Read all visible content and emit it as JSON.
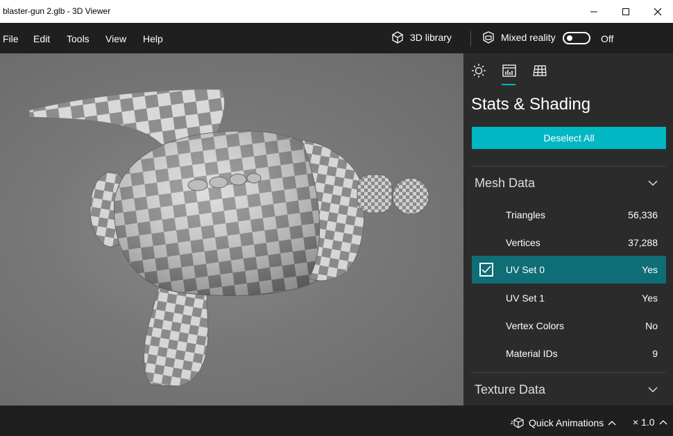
{
  "window": {
    "title": "blaster-gun 2.glb - 3D Viewer"
  },
  "menu": {
    "items": [
      "File",
      "Edit",
      "Tools",
      "View",
      "Help"
    ]
  },
  "toolbar": {
    "library_label": "3D library",
    "mixed_reality_label": "Mixed reality",
    "mixed_reality_state": "Off"
  },
  "panel": {
    "tabs": [
      "lighting-tab",
      "stats-tab",
      "grid-tab"
    ],
    "title": "Stats & Shading",
    "deselect_label": "Deselect All",
    "mesh_section": "Mesh Data",
    "rows": [
      {
        "label": "Triangles",
        "value": "56,336"
      },
      {
        "label": "Vertices",
        "value": "37,288"
      },
      {
        "label": "UV Set 0",
        "value": "Yes",
        "checked": true
      },
      {
        "label": "UV Set 1",
        "value": "Yes"
      },
      {
        "label": "Vertex Colors",
        "value": "No"
      },
      {
        "label": "Material IDs",
        "value": "9"
      }
    ],
    "texture_section": "Texture Data"
  },
  "status": {
    "animations_label": "Quick Animations",
    "speed": "× 1.0"
  },
  "colors": {
    "accent": "#00b7c3",
    "selected_row": "#0f6d76",
    "panel_bg": "#2b2b2b",
    "chrome_bg": "#1f1f1f"
  }
}
